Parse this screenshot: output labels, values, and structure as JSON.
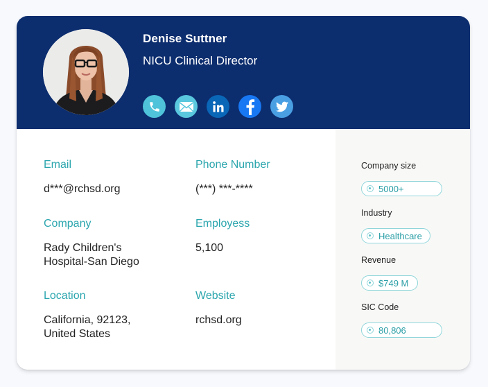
{
  "profile": {
    "name": "Denise Suttner",
    "title": "NICU Clinical Director",
    "avatar_alt": "Profile photo of Denise Suttner"
  },
  "socials": [
    {
      "name": "phone",
      "icon": "phone-icon",
      "color": "#4fc3d9"
    },
    {
      "name": "email",
      "icon": "envelope-icon",
      "color": "#59c7dd"
    },
    {
      "name": "linkedin",
      "icon": "linkedin-icon",
      "color": "#0a66b7"
    },
    {
      "name": "facebook",
      "icon": "facebook-icon",
      "color": "#1877f2"
    },
    {
      "name": "twitter",
      "icon": "twitter-icon",
      "color": "#4a9fe3"
    }
  ],
  "details": {
    "email": {
      "label": "Email",
      "value": "d***@rchsd.org"
    },
    "phone": {
      "label": "Phone Number",
      "value": "(***) ***-****"
    },
    "company": {
      "label": "Company",
      "value_line1": "Rady Children's",
      "value_line2": "Hospital-San Diego"
    },
    "employees": {
      "label": "Employess",
      "value": "5,100"
    },
    "location": {
      "label": "Location",
      "value_line1": "California, 92123,",
      "value_line2": "United States"
    },
    "website": {
      "label": "Website",
      "value": "rchsd.org"
    }
  },
  "firmographics": {
    "company_size": {
      "label": "Company size",
      "value": "5000+"
    },
    "industry": {
      "label": "Industry",
      "value": "Healthcare"
    },
    "revenue": {
      "label": "Revenue",
      "value": "$749 M"
    },
    "sic_code": {
      "label": "SIC Code",
      "value": "80,806"
    }
  },
  "colors": {
    "header_bg": "#0c2d6e",
    "accent": "#2aa5ad",
    "page_bg": "#f7f9fd",
    "side_bg": "#f8f9f7"
  }
}
